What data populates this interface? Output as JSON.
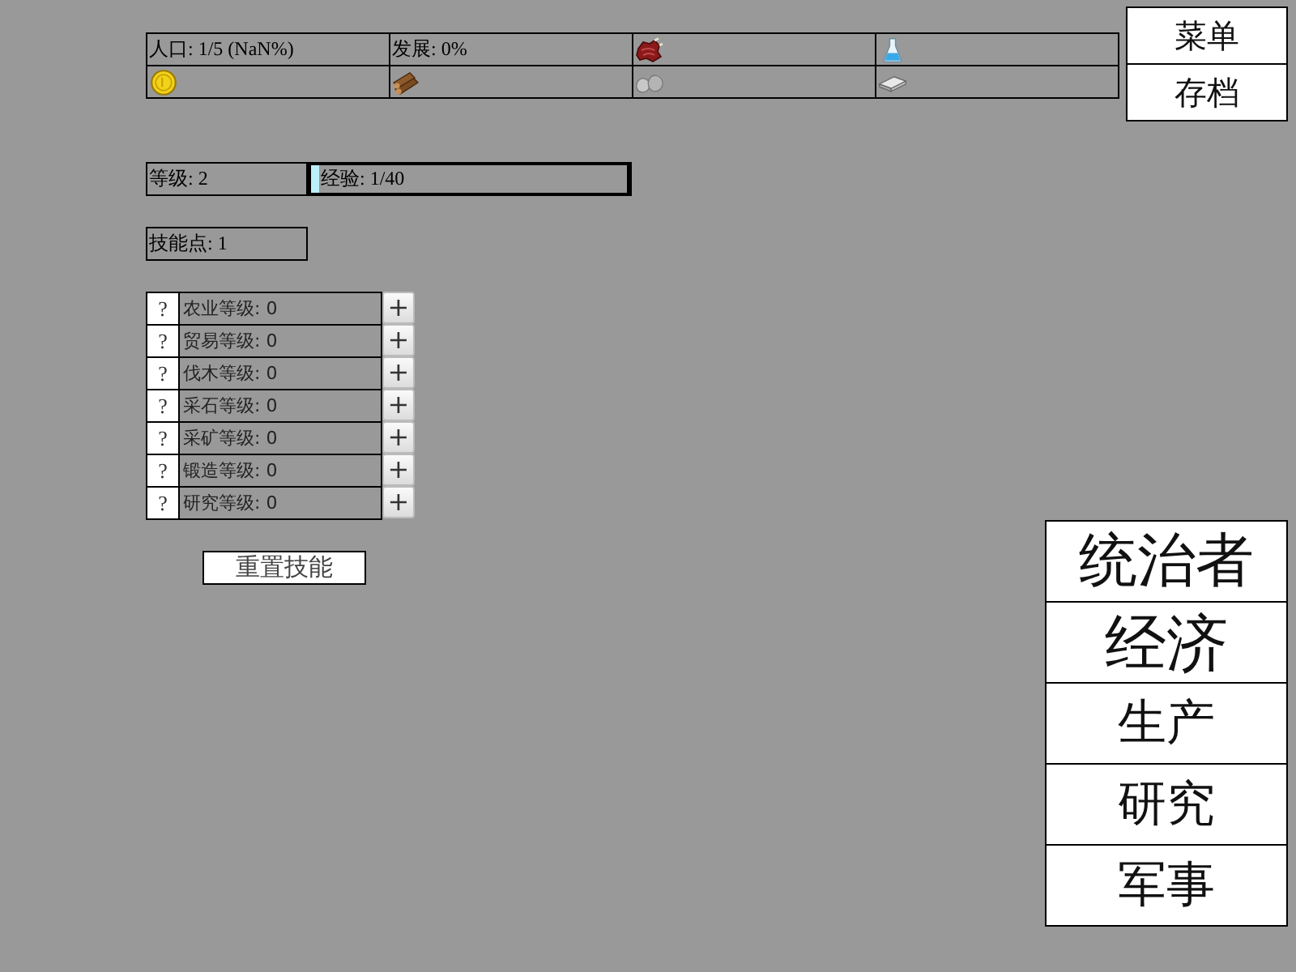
{
  "resource_table": {
    "cells": [
      "人口: 1/5 (NaN%)",
      "发展: 0%"
    ]
  },
  "level": {
    "label": "等级: 2"
  },
  "experience": {
    "label": "经验: 1/40",
    "level": 0.025
  },
  "skill_points": "技能点: 1",
  "skills": [
    {
      "help": "?",
      "label": "农业等级: 0",
      "add": "+"
    },
    {
      "help": "?",
      "label": "贸易等级: 0",
      "add": "+"
    },
    {
      "help": "?",
      "label": "伐木等级: 0",
      "add": "+"
    },
    {
      "help": "?",
      "label": "采石等级: 0",
      "add": "+"
    },
    {
      "help": "?",
      "label": "采矿等级: 0",
      "add": "+"
    },
    {
      "help": "?",
      "label": "锻造等级: 0",
      "add": "+"
    },
    {
      "help": "?",
      "label": "研究等级: 0",
      "add": "+"
    }
  ],
  "reset_button": "重置技能",
  "menu": [
    "菜单",
    "存档"
  ],
  "nav": [
    "统治者",
    "经济",
    "生产",
    "研究",
    "军事"
  ]
}
